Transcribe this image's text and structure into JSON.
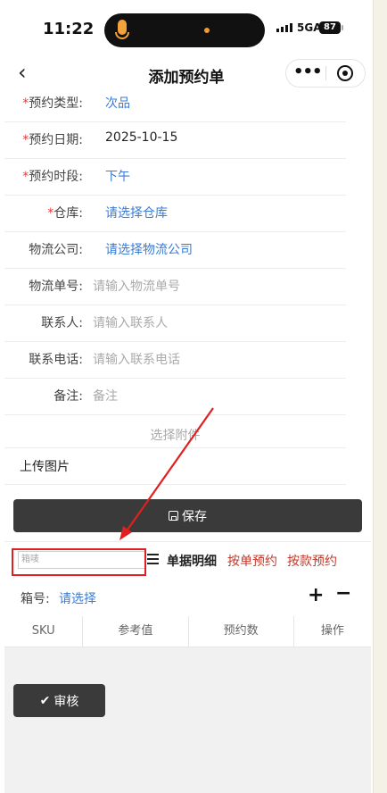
{
  "status_bar": {
    "time": "11:22",
    "network": "5GA",
    "battery": "87"
  },
  "nav": {
    "title": "添加预约单"
  },
  "form": {
    "rows": [
      {
        "label": "预约类型:",
        "required": "*",
        "value": "次品",
        "style": "link"
      },
      {
        "label": "预约日期:",
        "required": "*",
        "value": "2025-10-15",
        "style": "text"
      },
      {
        "label": "预约时段:",
        "required": "*",
        "value": "下午",
        "style": "link"
      },
      {
        "label": "仓库:",
        "required": "*",
        "value": "请选择仓库",
        "style": "link"
      },
      {
        "label": "物流公司:",
        "required": "",
        "value": "请选择物流公司",
        "style": "link"
      },
      {
        "label": "物流单号:",
        "required": "",
        "value": "请输入物流单号",
        "style": "placeholder"
      },
      {
        "label": "联系人:",
        "required": "",
        "value": "请输入联系人",
        "style": "placeholder"
      },
      {
        "label": "联系电话:",
        "required": "",
        "value": "请输入联系电话",
        "style": "placeholder"
      },
      {
        "label": "备注:",
        "required": "",
        "value": "备注",
        "style": "placeholder"
      }
    ],
    "attachment": "选择附件",
    "upload_images": "上传图片"
  },
  "save_button": "保存",
  "toolbar": {
    "box_input_placeholder": "箱唛",
    "detail_label": "单据明细",
    "tab_by_order": "按单预约",
    "tab_by_style": "按款预约"
  },
  "box_no": {
    "label": "箱号:",
    "value": "请选择",
    "plus": "+",
    "minus": "−"
  },
  "table": {
    "columns": [
      "SKU",
      "参考值",
      "预约数",
      "操作"
    ]
  },
  "audit_button": "审核",
  "colors": {
    "link": "#3a7bd5",
    "required": "#e23b3b",
    "tab_red": "#c0392b",
    "button_bg": "#3a3a3a",
    "annotation_red": "#e02020"
  }
}
